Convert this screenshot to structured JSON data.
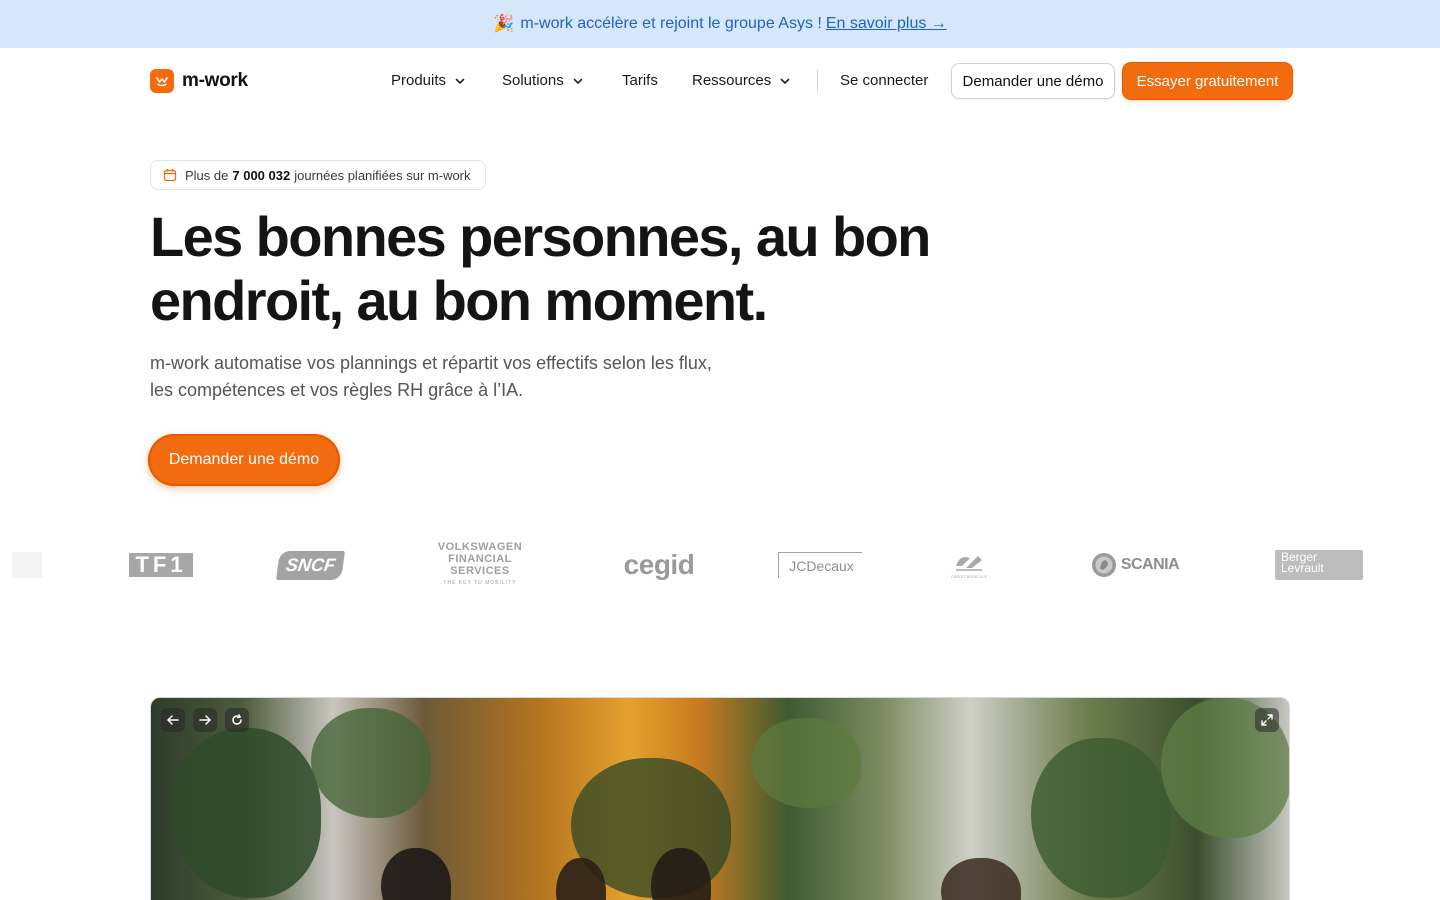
{
  "announcement": {
    "emoji": "🎉",
    "text": "m-work accélère et rejoint le groupe Asys !",
    "link": "En savoir plus →"
  },
  "header": {
    "logo_text": "m-work",
    "nav": [
      {
        "label": "Produits",
        "has_dropdown": true
      },
      {
        "label": "Solutions",
        "has_dropdown": true
      },
      {
        "label": "Tarifs",
        "has_dropdown": false
      },
      {
        "label": "Ressources",
        "has_dropdown": true
      }
    ],
    "login": "Se connecter",
    "demo_button": "Demander une démo",
    "trial_button": "Essayer gratuitement"
  },
  "hero": {
    "stat_prefix": "Plus de",
    "stat_value": "7 000 032",
    "stat_suffix": "journées planifiées sur m-work",
    "headline": "Les bonnes personnes, au bon endroit, au bon moment.",
    "subtext_line1": "m-work automatise vos plannings et répartit vos effectifs selon les flux,",
    "subtext_line2": "les compétences et vos règles RH grâce à l’IA.",
    "cta": "Demander une démo"
  },
  "clients": {
    "tf1": "TF1",
    "sncf": "SNCF",
    "vw_line1": "VOLKSWAGEN",
    "vw_line2": "FINANCIAL SERVICES",
    "vw_line3": "THE KEY TO MOBILITY",
    "cegid": "cegid",
    "jcdecaux": "JCDecaux",
    "credit_agricole": "CRÉDIT AGRICOLE",
    "scania": "SCANIA",
    "berger_line1": "Berger",
    "berger_line2": "Levrault"
  },
  "colors": {
    "brand_orange": "#f26b0f",
    "announce_bg": "#d6e7fb",
    "announce_text": "#1c64c8"
  }
}
